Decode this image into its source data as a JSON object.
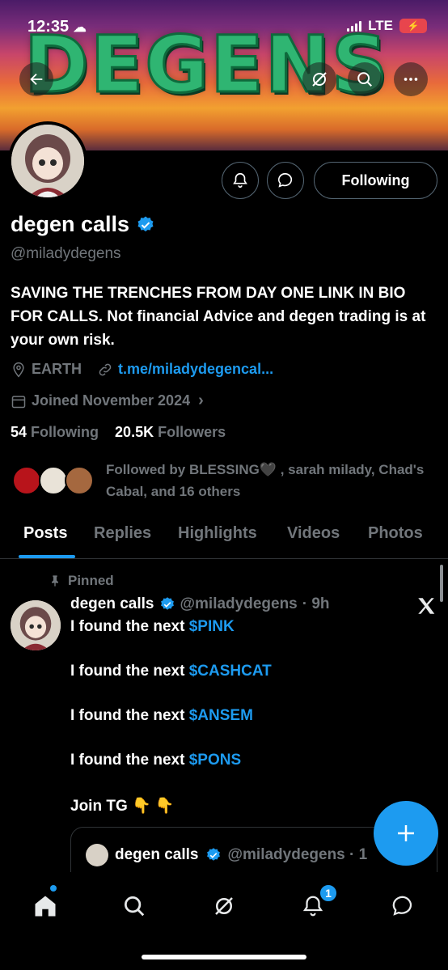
{
  "status_bar": {
    "time": "12:35",
    "network": "LTE"
  },
  "banner": {
    "title": "DEGENS"
  },
  "profile": {
    "name": "degen calls",
    "handle": "@miladydegens",
    "follow_button": "Following",
    "bio": "SAVING THE TRENCHES FROM DAY ONE LINK IN BIO FOR CALLS. Not financial Advice and degen trading is at your own risk.",
    "location": "EARTH",
    "link": "t.me/miladydegencal...",
    "joined": "Joined November 2024",
    "following_count": "54",
    "following_label": "Following",
    "followers_count": "20.5K",
    "followers_label": "Followers",
    "followed_by": "Followed by BLESSING🖤 , sarah milady, Chad's Cabal, and 16 others"
  },
  "tabs": [
    "Posts",
    "Replies",
    "Highlights",
    "Videos",
    "Photos"
  ],
  "post": {
    "pinned_label": "Pinned",
    "author": "degen calls",
    "handle": "@miladydegens",
    "time": "· 9h",
    "prefix": "I found the next ",
    "lines": [
      "$PINK",
      "$CASHCAT",
      "$ANSEM",
      "$PONS"
    ],
    "join_text": "Join TG 👇 👇",
    "quote_author": "degen calls",
    "quote_handle": "@miladydegens · 1"
  },
  "notification_badge": "1",
  "colors": {
    "accent": "#1d9bf0",
    "muted": "#71767b",
    "border": "#2f3336"
  },
  "icons": [
    "back-arrow-icon",
    "grok-icon",
    "search-icon",
    "more-icon",
    "bell-add-icon",
    "message-icon",
    "verified-badge-icon",
    "location-icon",
    "link-icon",
    "calendar-icon",
    "pin-icon",
    "x-logo-icon",
    "plus-icon",
    "home-icon",
    "bell-icon",
    "mail-icon"
  ]
}
